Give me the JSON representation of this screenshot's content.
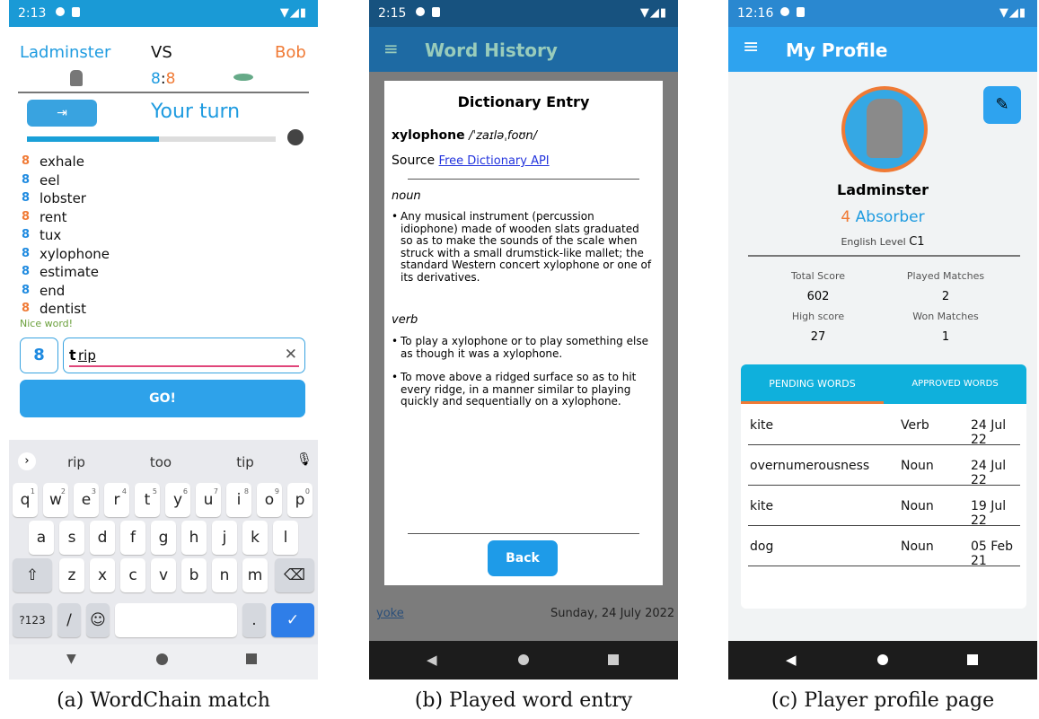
{
  "match": {
    "status_time": "2:13",
    "player1": "Ladminster",
    "vs": "VS",
    "player2": "Bob",
    "score_left": "8",
    "score_sep": ":",
    "score_right": "8",
    "turn_text": "Your turn",
    "words": [
      {
        "word": "exhale",
        "color": "orange"
      },
      {
        "word": "eel",
        "color": "blue"
      },
      {
        "word": "lobster",
        "color": "blue"
      },
      {
        "word": "rent",
        "color": "orange"
      },
      {
        "word": "tux",
        "color": "blue"
      },
      {
        "word": "xylophone",
        "color": "blue"
      },
      {
        "word": "estimate",
        "color": "blue"
      },
      {
        "word": "end",
        "color": "blue"
      },
      {
        "word": "dentist",
        "color": "orange"
      }
    ],
    "feedback": "Nice word!",
    "input_prefix": "t",
    "input_value": "rip",
    "go_label": "GO!",
    "timer_fraction": 0.53,
    "suggestions": [
      "rip",
      "too",
      "tip"
    ],
    "key_rows": [
      [
        {
          "k": "q",
          "n": "1"
        },
        {
          "k": "w",
          "n": "2"
        },
        {
          "k": "e",
          "n": "3"
        },
        {
          "k": "r",
          "n": "4"
        },
        {
          "k": "t",
          "n": "5"
        },
        {
          "k": "y",
          "n": "6"
        },
        {
          "k": "u",
          "n": "7"
        },
        {
          "k": "i",
          "n": "8"
        },
        {
          "k": "o",
          "n": "9"
        },
        {
          "k": "p",
          "n": "0"
        }
      ],
      [
        {
          "k": "a"
        },
        {
          "k": "s"
        },
        {
          "k": "d"
        },
        {
          "k": "f"
        },
        {
          "k": "g"
        },
        {
          "k": "h"
        },
        {
          "k": "j"
        },
        {
          "k": "k"
        },
        {
          "k": "l"
        }
      ],
      [
        {
          "k": "z"
        },
        {
          "k": "x"
        },
        {
          "k": "c"
        },
        {
          "k": "v"
        },
        {
          "k": "b"
        },
        {
          "k": "n"
        },
        {
          "k": "m"
        }
      ]
    ],
    "key_symbols": "?123",
    "key_slash": "/",
    "key_period": ".",
    "caption": "(a) WordChain match"
  },
  "history": {
    "status_time": "2:15",
    "title": "Word History",
    "dialog_title": "Dictionary Entry",
    "word": "xylophone",
    "phonetic": "/ˈzaɪləˌfoʊn/",
    "source_label": "Source",
    "source_link": "Free Dictionary API",
    "pos1": "noun",
    "def1": "Any musical instrument (percussion idiophone) made of wooden slats graduated so as to make the sounds of the scale when struck with a small drumstick-like mallet; the standard Western concert xylophone or one of its derivatives.",
    "pos2": "verb",
    "def2": "To play a xylophone or to play something else as though it was a xylophone.",
    "def3": "To move above a ridged surface so as to hit every ridge, in a manner similar to playing quickly and sequentially on a xylophone.",
    "back_label": "Back",
    "bg_row_word": "yoke",
    "bg_row_date": "Sunday, 24 July 2022",
    "caption": "(b) Played word entry"
  },
  "profile": {
    "status_time": "12:16",
    "title": "My Profile",
    "name": "Ladminster",
    "level_num": "4",
    "level_name": "Absorber",
    "english_label": "English Level",
    "english_value": "C1",
    "total_score_label": "Total Score",
    "total_score": "602",
    "played_label": "Played Matches",
    "played": "2",
    "high_label": "High score",
    "high": "27",
    "won_label": "Won Matches",
    "won": "1",
    "tab_pending": "PENDING WORDS",
    "tab_approved": "APPROVED WORDS",
    "rows": [
      {
        "word": "kite",
        "type": "Verb",
        "date": "24 Jul 22"
      },
      {
        "word": "overnumerousness",
        "type": "Noun",
        "date": "24 Jul 22"
      },
      {
        "word": "kite",
        "type": "Noun",
        "date": "19 Jul 22"
      },
      {
        "word": "dog",
        "type": "Noun",
        "date": "05 Feb 21"
      }
    ],
    "caption": "(c) Player profile page"
  },
  "colors": {
    "accent_blue": "#1e9be0",
    "brand_orange": "#f07a35",
    "cyan": "#0fb0dc",
    "nav_dark": "#1c1c1c"
  },
  "icons": [
    "exit-icon",
    "stopwatch-icon",
    "chain-icon",
    "clear-icon",
    "mic-icon",
    "backspace-icon",
    "menu-icon",
    "edit-icon",
    "moai-avatar",
    "ufo-icon"
  ]
}
